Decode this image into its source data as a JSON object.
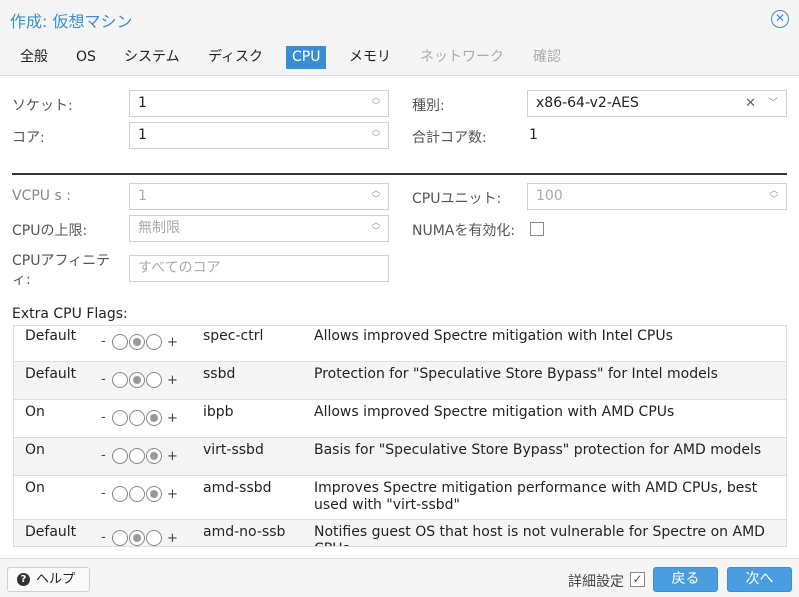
{
  "window": {
    "title": "作成: 仮想マシン",
    "close_icon": "✕"
  },
  "tabs": [
    {
      "label": "全般",
      "state": "normal"
    },
    {
      "label": "OS",
      "state": "normal"
    },
    {
      "label": "システム",
      "state": "normal"
    },
    {
      "label": "ディスク",
      "state": "normal"
    },
    {
      "label": "CPU",
      "state": "active"
    },
    {
      "label": "メモリ",
      "state": "normal"
    },
    {
      "label": "ネットワーク",
      "state": "disabled"
    },
    {
      "label": "確認",
      "state": "disabled"
    }
  ],
  "basic": {
    "sockets_label": "ソケット:",
    "sockets_value": "1",
    "cores_label": "コア:",
    "cores_value": "1",
    "type_label": "種別:",
    "type_value": "x86-64-v2-AES",
    "total_cores_label": "合計コア数:",
    "total_cores_value": "1"
  },
  "advanced": {
    "vcpus_label": "VCPU s :",
    "vcpus_value": "1",
    "cpulimit_label": "CPUの上限:",
    "cpulimit_value": "無制限",
    "affinity_label": "CPUアフィニティ:",
    "affinity_placeholder": "すべてのコア",
    "cpuunits_label": "CPUユニット:",
    "cpuunits_value": "100",
    "numa_label": "NUMAを有効化:",
    "numa_checked": false
  },
  "flags": {
    "title": "Extra CPU Flags:",
    "rows": [
      {
        "state": "Default",
        "name": "spec-ctrl",
        "description": "Allows improved Spectre mitigation with Intel CPUs"
      },
      {
        "state": "Default",
        "name": "ssbd",
        "description": "Protection for \"Speculative Store Bypass\" for Intel models"
      },
      {
        "state": "On",
        "name": "ibpb",
        "description": "Allows improved Spectre mitigation with AMD CPUs"
      },
      {
        "state": "On",
        "name": "virt-ssbd",
        "description": "Basis for \"Speculative Store Bypass\" protection for AMD models"
      },
      {
        "state": "On",
        "name": "amd-ssbd",
        "description": "Improves Spectre mitigation performance with AMD CPUs, best used with \"virt-ssbd\""
      },
      {
        "state": "Default",
        "name": "amd-no-ssb",
        "description": "Notifies guest OS that host is not vulnerable for Spectre on AMD CPUs"
      }
    ],
    "minus": "-",
    "plus": "+"
  },
  "footer": {
    "help_label": "ヘルプ",
    "help_icon": "?",
    "advanced_label": "詳細設定",
    "advanced_checked": true,
    "back_label": "戻る",
    "next_label": "次へ"
  },
  "colors": {
    "accent": "#3a8fd4"
  }
}
